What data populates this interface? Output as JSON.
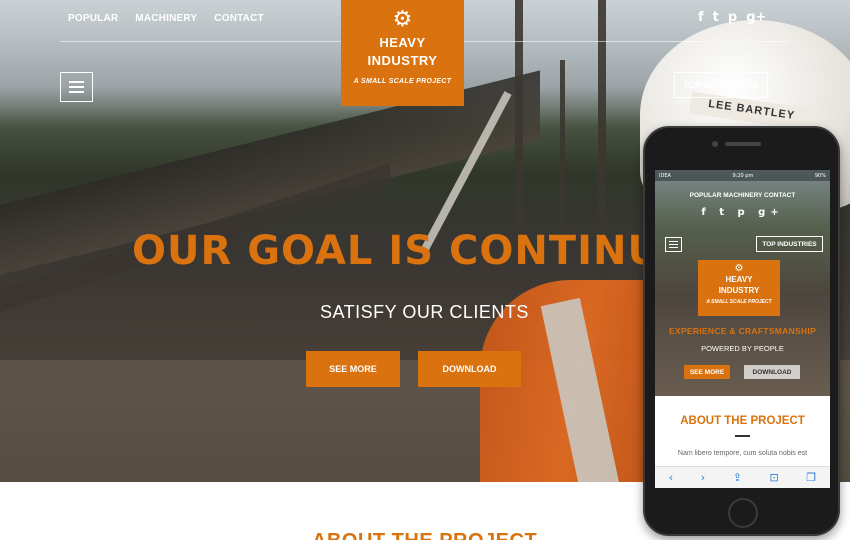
{
  "nav": {
    "items": [
      "POPULAR",
      "MACHINERY",
      "CONTACT"
    ]
  },
  "social": {
    "icons": [
      "f",
      "t",
      "p",
      "g+"
    ],
    "names": [
      "facebook-icon",
      "twitter-icon",
      "pinterest-icon",
      "googleplus-icon"
    ]
  },
  "logo": {
    "icon": "⚙",
    "line1": "HEAVY",
    "line2": "INDUSTRY",
    "tagline": "A SMALL SCALE PROJECT"
  },
  "header": {
    "top_industries": "TOP INDUSTRIES"
  },
  "hero": {
    "headline": "OUR GOAL IS CONTINUOUS",
    "subheadline": "SATISFY OUR CLIENTS",
    "see_more": "SEE MORE",
    "download": "DOWNLOAD",
    "helmet_text": "LEE BARTLEY"
  },
  "about": {
    "title": "ABOUT THE PROJECT"
  },
  "phone": {
    "status": {
      "carrier": "IDEA",
      "time": "9:20 pm",
      "battery": "90%"
    },
    "nav": "POPULAR  MACHINERY  CONTACT",
    "social": "f t p g+",
    "top_industries": "TOP INDUSTRIES",
    "logo": {
      "icon": "⚙",
      "line1": "HEAVY",
      "line2": "INDUSTRY",
      "tagline": "A SMALL SCALE PROJECT"
    },
    "experience": "EXPERIENCE & CRAFTSMANSHIP",
    "powered": "POWERED BY PEOPLE",
    "see_more": "SEE MORE",
    "download": "DOWNLOAD",
    "about_title": "ABOUT THE PROJECT",
    "paragraph": "Nam libero tempore, cum soluta nobis est",
    "browser_bar": {
      "back": "‹",
      "forward": "›",
      "share": "⇪",
      "bookmarks": "⊡",
      "tabs": "❐"
    }
  },
  "colors": {
    "accent": "#d9720f",
    "white": "#ffffff"
  }
}
